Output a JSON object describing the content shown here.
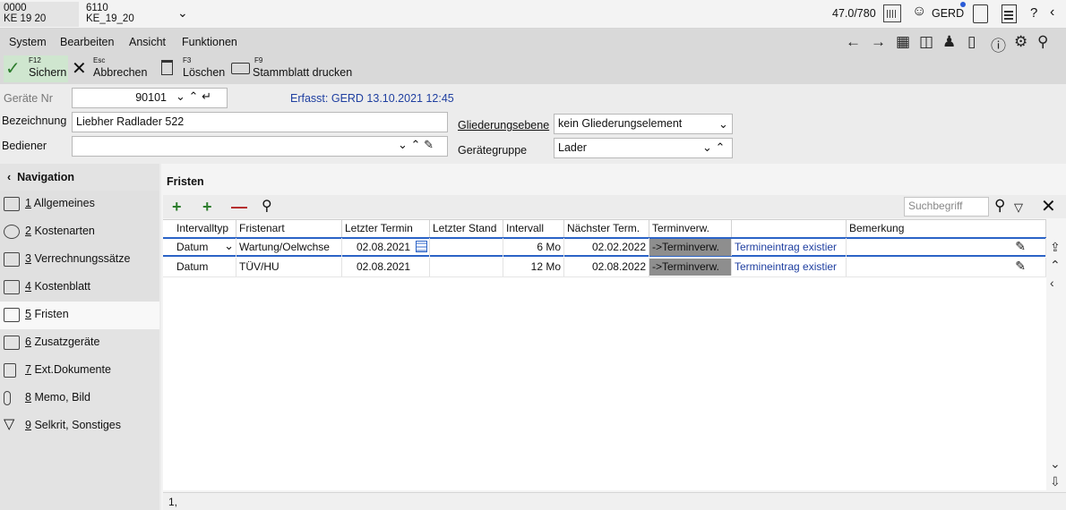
{
  "context": {
    "item1": {
      "line1": "0000",
      "line2": "KE 19 20"
    },
    "item2": {
      "line1": "6110",
      "line2": "KE_19_20"
    }
  },
  "topbar": {
    "counter": "47.0/780",
    "user": "GERD",
    "help": "?"
  },
  "menu": {
    "system": "System",
    "bearbeiten": "Bearbeiten",
    "ansicht": "Ansicht",
    "funktionen": "Funktionen"
  },
  "toolbar": {
    "save": {
      "key": "F12",
      "label": "Sichern"
    },
    "cancel": {
      "key": "Esc",
      "label": "Abbrechen"
    },
    "delete": {
      "key": "F3",
      "label": "Löschen"
    },
    "print": {
      "key": "F9",
      "label": "Stammblatt drucken"
    }
  },
  "header": {
    "geraete_nr_label": "Geräte Nr",
    "geraete_nr_value": "90101",
    "erfasst": "Erfasst: GERD 13.10.2021 12:45",
    "bezeichnung_label": "Bezeichnung",
    "bezeichnung_value": "Liebher Radlader 522",
    "bediener_label": "Bediener",
    "bediener_value": "",
    "gliederung_label": "Gliederungsebene",
    "gliederung_value": "kein Gliederungselement",
    "gruppe_label": "Gerätegruppe",
    "gruppe_value": "Lader"
  },
  "navigation": {
    "title": "Navigation",
    "items": [
      {
        "num": "1",
        "label": "Allgemeines"
      },
      {
        "num": "2",
        "label": "Kostenarten"
      },
      {
        "num": "3",
        "label": "Verrechnungssätze"
      },
      {
        "num": "4",
        "label": "Kostenblatt"
      },
      {
        "num": "5",
        "label": "Fristen"
      },
      {
        "num": "6",
        "label": "Zusatzgeräte"
      },
      {
        "num": "7",
        "label": "Ext.Dokumente"
      },
      {
        "num": "8",
        "label": "Memo, Bild"
      },
      {
        "num": "9",
        "label": "Selkrit, Sonstiges"
      }
    ]
  },
  "fristen": {
    "title": "Fristen",
    "search_placeholder": "Suchbegriff",
    "columns": [
      "Intervalltyp",
      "Fristenart",
      "Letzter Termin",
      "Letzter Stand",
      "Intervall",
      "Nächster Term.",
      "Terminverw.",
      "",
      "Bemerkung"
    ],
    "rows": [
      {
        "typ": "Datum",
        "art": "Wartung/Oelwchse",
        "letzter_termin": "02.08.2021",
        "letzter_stand": "",
        "intervall": "6 Mo",
        "naechster": "02.02.2022",
        "terminverw": "->Terminverw.",
        "status": "Termineintrag existier",
        "bemerkung": ""
      },
      {
        "typ": "Datum",
        "art": "TÜV/HU",
        "letzter_termin": "02.08.2021",
        "letzter_stand": "",
        "intervall": "12 Mo",
        "naechster": "02.08.2022",
        "terminverw": "->Terminverw.",
        "status": "Termineintrag existier",
        "bemerkung": ""
      }
    ],
    "status_bar": "1,"
  }
}
